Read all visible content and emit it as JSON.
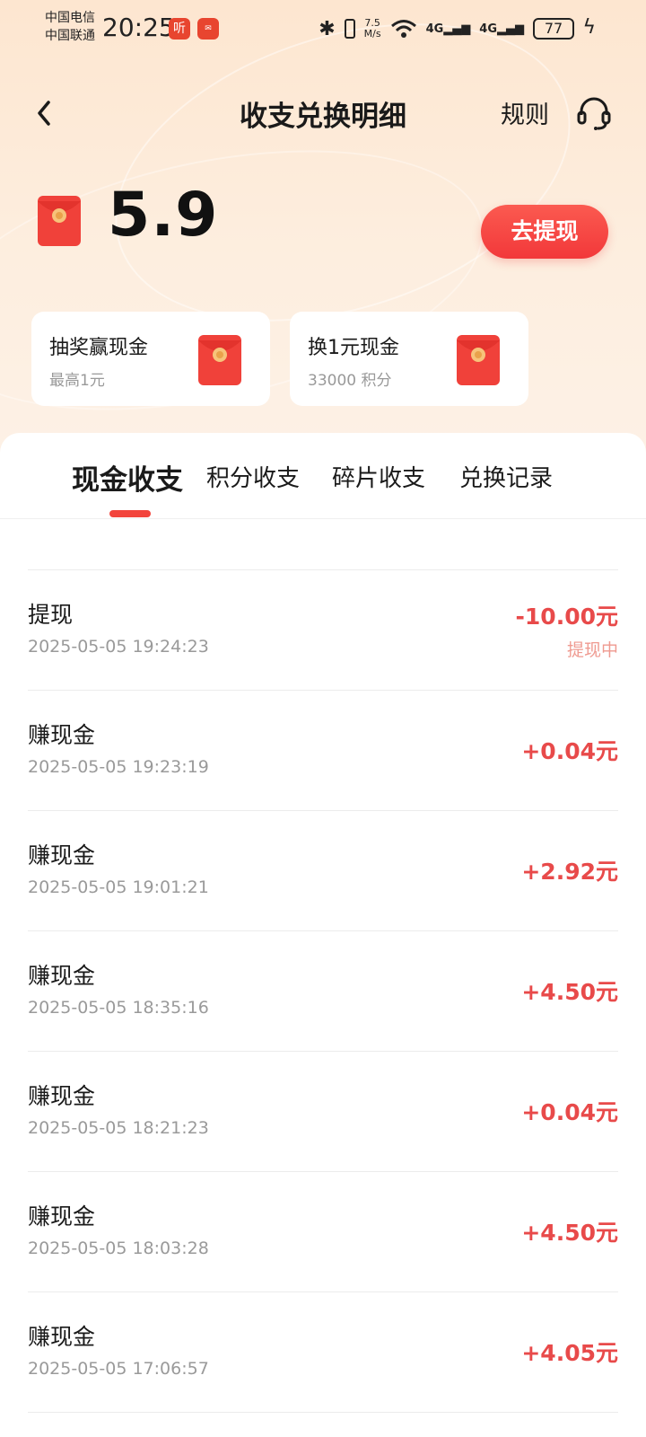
{
  "status_bar": {
    "carrier_1": "中国电信",
    "carrier_2": "中国联通",
    "time": "20:25",
    "app_badge_1": "听",
    "net_speed_value": "7.5",
    "net_speed_unit": "M/s",
    "signal_1": "4G",
    "signal_2": "4G",
    "battery": "77"
  },
  "header": {
    "title": "收支兑换明细",
    "rules_label": "规则"
  },
  "balance": {
    "amount": "5.9",
    "withdraw_label": "去提现"
  },
  "cards": [
    {
      "title": "抽奖赢现金",
      "subtitle": "最高1元"
    },
    {
      "title": "换1元现金",
      "subtitle": "33000 积分"
    }
  ],
  "tabs": [
    {
      "label": "现金收支",
      "active": true
    },
    {
      "label": "积分收支",
      "active": false
    },
    {
      "label": "碎片收支",
      "active": false
    },
    {
      "label": "兑换记录",
      "active": false
    }
  ],
  "records": [
    {
      "title": "提现",
      "time": "2025-05-05 19:24:23",
      "amount": "-10.00元",
      "status": "提现中"
    },
    {
      "title": "赚现金",
      "time": "2025-05-05 19:23:19",
      "amount": "+0.04元"
    },
    {
      "title": "赚现金",
      "time": "2025-05-05 19:01:21",
      "amount": "+2.92元"
    },
    {
      "title": "赚现金",
      "time": "2025-05-05 18:35:16",
      "amount": "+4.50元"
    },
    {
      "title": "赚现金",
      "time": "2025-05-05 18:21:23",
      "amount": "+0.04元"
    },
    {
      "title": "赚现金",
      "time": "2025-05-05 18:03:28",
      "amount": "+4.50元"
    },
    {
      "title": "赚现金",
      "time": "2025-05-05 17:06:57",
      "amount": "+4.05元"
    }
  ],
  "colors": {
    "accent_red": "#f2443c",
    "amount_red": "#e84a4a",
    "pending_pink": "#ef9a90",
    "header_bg": "#fde6d0"
  }
}
